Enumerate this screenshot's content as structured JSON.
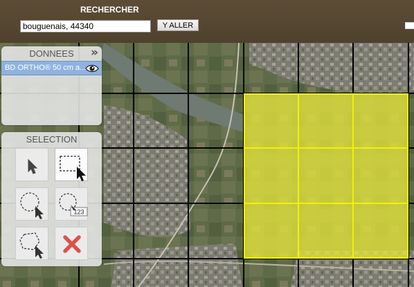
{
  "header": {
    "search_title": "RECHERCHER",
    "search_value": "bouguenais, 44340",
    "go_button": "Y ALLER"
  },
  "donnees_panel": {
    "title": "DONNEES",
    "collapse_icon": "double-chevron-right-icon",
    "layers": [
      {
        "name": "BD ORTHO® 50 cm a...",
        "visibility_icon": "eye-icon",
        "selected": true
      }
    ]
  },
  "selection_panel": {
    "title": "SELECTION",
    "tools": [
      {
        "name": "pointer-tool",
        "icon": "cursor-arrow-icon",
        "active": false
      },
      {
        "name": "rectangle-select-tool",
        "icon": "dashed-rectangle-cursor-icon",
        "active": true
      },
      {
        "name": "circle-select-tool",
        "icon": "dashed-circle-cursor-icon",
        "active": false
      },
      {
        "name": "circle-radius-select-tool",
        "icon": "dashed-circle-radius-icon",
        "active": false,
        "label": "123"
      },
      {
        "name": "polygon-select-tool",
        "icon": "dashed-polygon-cursor-icon",
        "active": false
      },
      {
        "name": "clear-selection-tool",
        "icon": "red-x-icon",
        "active": false
      }
    ]
  },
  "colors": {
    "header_bg": "#5b4a32",
    "selection_fill": "#e6e63c",
    "selection_border": "#f2f200",
    "grid_line": "#000000",
    "layer_selected_bg": "#8fb2df",
    "clear_icon": "#d9534f"
  }
}
